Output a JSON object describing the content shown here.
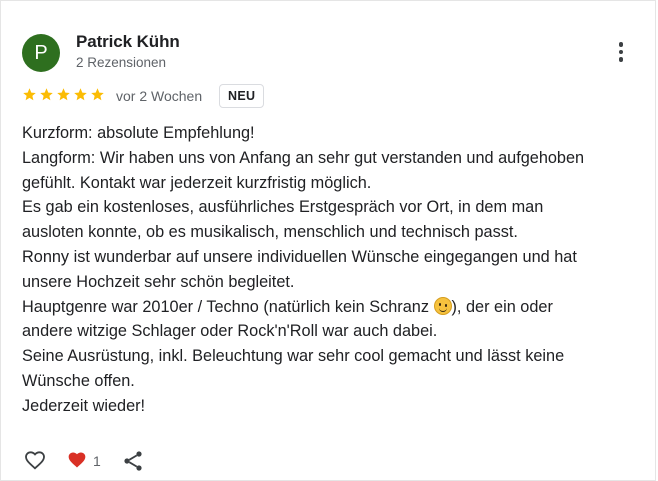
{
  "review": {
    "avatar_letter": "P",
    "author": "Patrick Kühn",
    "review_count": "2 Rezensionen",
    "rating": 5,
    "time": "vor 2 Wochen",
    "badge": "NEU",
    "lines": [
      "Kurzform: absolute Empfehlung!",
      "Langform: Wir haben uns von Anfang an sehr gut verstanden und aufgehoben",
      "gefühlt. Kontakt war jederzeit kurzfristig möglich.",
      "Es gab ein kostenloses, ausführliches Erstgespräch vor Ort, in dem man",
      "ausloten konnte, ob es musikalisch, menschlich und technisch passt.",
      "Ronny ist wunderbar auf unsere individuellen Wünsche eingegangen und hat",
      "unsere Hochzeit sehr schön begleitet.",
      "Hauptgenre war 2010er / Techno (natürlich kein Schranz",
      "andere witzige Schlager oder Rock'n'Roll war auch dabei.",
      "Seine Ausrüstung, inkl. Beleuchtung war sehr cool gemacht und lässt keine",
      "Wünsche offen.",
      "Jederzeit wieder!"
    ],
    "line8_after_emoji": "), der ein oder",
    "emoji": "wink-emoji",
    "like_count": "1"
  },
  "icons": {
    "more": "more-vert-icon",
    "like": "heart-outline-icon",
    "reaction": "heart-filled-icon",
    "share": "share-icon",
    "star": "star-icon"
  },
  "colors": {
    "avatar_bg": "#2e6f1f",
    "star": "#fbbc04",
    "reaction_heart": "#d93025",
    "text": "#202124",
    "secondary_text": "#5f6368"
  }
}
